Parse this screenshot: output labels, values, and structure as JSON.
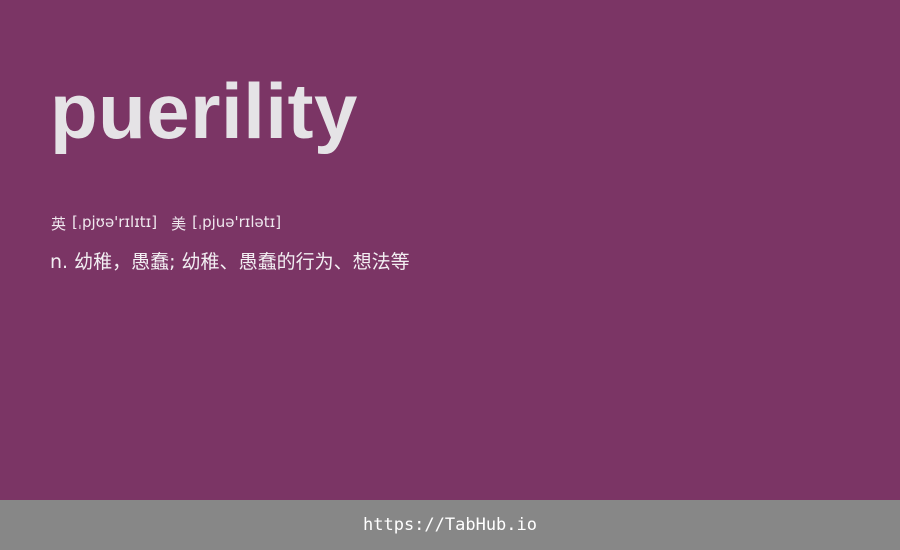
{
  "word": "puerility",
  "phonetics": {
    "uk_label": "英",
    "uk_ipa": "[ˌpjʊə'rɪlɪtɪ]",
    "us_label": "美",
    "us_ipa": "[ˌpjuə'rɪlətɪ]"
  },
  "definition": "n. 幼稚，愚蠢; 幼稚、愚蠢的行为、想法等",
  "footer": {
    "link_text": "https://TabHub.io"
  },
  "colors": {
    "background": "#7b3565",
    "footer_background": "#878787",
    "text": "#e5e3e6"
  }
}
